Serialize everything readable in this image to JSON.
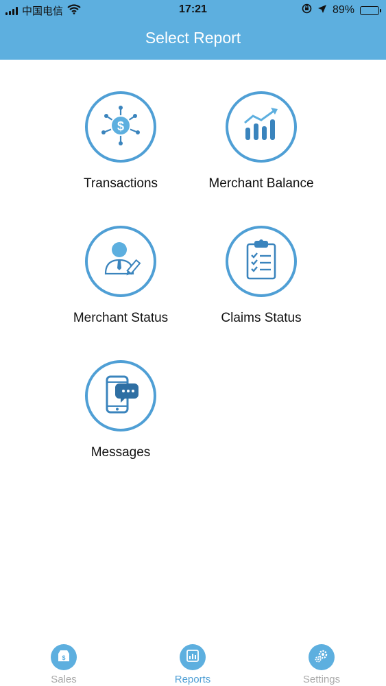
{
  "status_bar": {
    "carrier": "中国电信",
    "time": "17:21",
    "battery": "89%",
    "battery_level": 0.89,
    "icons": [
      "signal-icon",
      "wifi-icon",
      "orientation-lock-icon",
      "location-arrow-icon",
      "battery-icon"
    ]
  },
  "header": {
    "title": "Select Report"
  },
  "reports": [
    {
      "label": "Transactions",
      "icon": "transactions-dollar-network-icon"
    },
    {
      "label": "Merchant Balance",
      "icon": "bar-chart-growth-icon"
    },
    {
      "label": "Merchant Status",
      "icon": "merchant-person-pen-icon"
    },
    {
      "label": "Claims Status",
      "icon": "clipboard-checklist-icon"
    },
    {
      "label": "Messages",
      "icon": "phone-message-icon"
    }
  ],
  "tabs": [
    {
      "label": "Sales",
      "icon": "sales-tag-icon",
      "active": false
    },
    {
      "label": "Reports",
      "icon": "reports-chart-icon",
      "active": true
    },
    {
      "label": "Settings",
      "icon": "settings-gear-icon",
      "active": false
    }
  ],
  "colors": {
    "header_bg": "#5dafdf",
    "accent": "#4f9fd5",
    "inactive_tab": "#a9a9a9"
  }
}
